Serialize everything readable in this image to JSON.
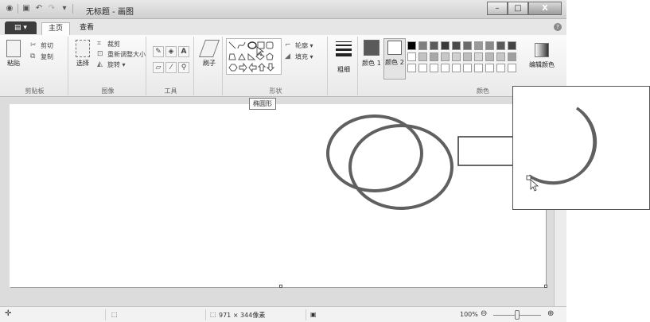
{
  "window": {
    "title": "无标题 - 画图",
    "controls": {
      "minimize": "–",
      "maximize": "□",
      "close": "X"
    }
  },
  "quick_access": {
    "icons": [
      "paint-app-icon",
      "save-icon",
      "undo-icon",
      "redo-icon",
      "customize-icon"
    ]
  },
  "tabs": {
    "file": "▤ ▾",
    "home": "主页",
    "view": "查看"
  },
  "ribbon": {
    "clipboard": {
      "label": "剪贴板",
      "paste": "粘贴",
      "cut": "剪切",
      "copy": "复制"
    },
    "image": {
      "label": "图像",
      "select": "选择",
      "crop": "裁剪",
      "resize": "重新调整大小",
      "rotate": "旋转 ▾"
    },
    "tools": {
      "label": "工具"
    },
    "brushes": {
      "label": "刷子"
    },
    "shapes": {
      "label": "形状",
      "outline": "轮廓 ▾",
      "fill": "填充 ▾"
    },
    "size": {
      "label": "粗细"
    },
    "color1": {
      "label": "颜色 1"
    },
    "color2": {
      "label": "颜色 2"
    },
    "colors": {
      "label": "颜色",
      "edit": "编辑颜色",
      "color1_value": "#5a5a5a",
      "color2_value": "#ffffff"
    }
  },
  "tooltip": "椭圆形",
  "statusbar": {
    "canvas_size": "971 × 344像素",
    "zoom": "100%"
  }
}
